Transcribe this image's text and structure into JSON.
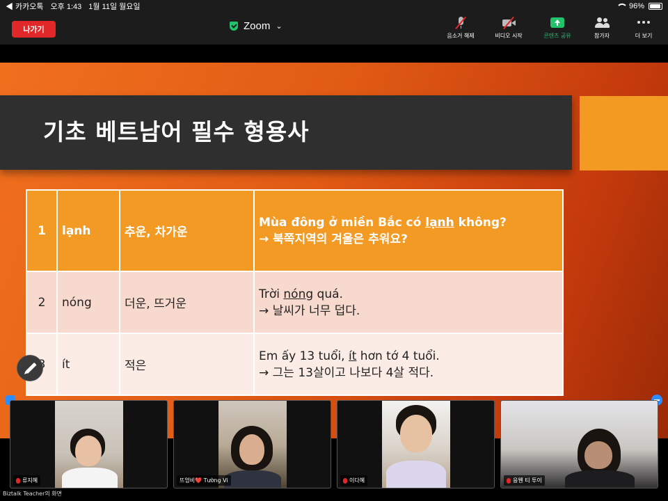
{
  "status_bar": {
    "back_app": "◀ 카카오톡",
    "time": "오후 1:43",
    "date": "1월 11일 월요일",
    "battery": "96%"
  },
  "toolbar": {
    "leave_label": "나가기",
    "meeting_title": "Zoom",
    "mute_label": "음소거 해제",
    "video_label": "비디오 시작",
    "share_label": "콘텐츠 공유",
    "participants_label": "참가자",
    "more_label": "더 보기",
    "colors": {
      "leave": "#e02828",
      "share": "#23c36b"
    }
  },
  "slide": {
    "title": "기초 베트남어 필수 형용사",
    "rows": [
      {
        "no": "1",
        "vi": "lạnh",
        "ko": "추운, 차가운",
        "ex_pre": "Mùa đông ở miền Bắc có ",
        "ex_word": "lạnh",
        "ex_post": " không?",
        "trans": "→ 북쪽지역의 겨울은 추워요?"
      },
      {
        "no": "2",
        "vi": "nóng",
        "ko": "더운, 뜨거운",
        "ex_pre": "Trời ",
        "ex_word": "nóng",
        "ex_post": " quá.",
        "trans": "→ 날씨가 너무 덥다."
      },
      {
        "no": "3",
        "vi": "ít",
        "ko": "적은",
        "ex_pre": "Em ấy 13 tuổi, ",
        "ex_word": "ít",
        "ex_post": " hơn tớ 4 tuổi.",
        "trans": "→ 그는 13살이고 나보다 4살 적다."
      }
    ]
  },
  "participants": [
    {
      "name": "류지혜"
    },
    {
      "name": "뜨엉비❤️ Tường Vi"
    },
    {
      "name": "이다혜"
    },
    {
      "name": "응웬 티 투이"
    }
  ],
  "share_caption": "Biztalk Teacher의 화면"
}
